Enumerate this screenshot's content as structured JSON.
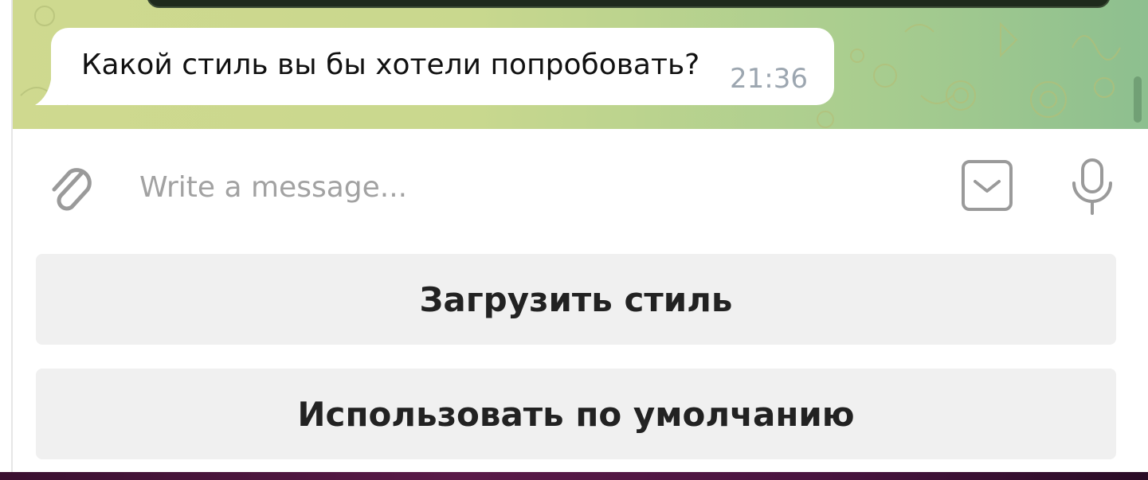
{
  "chat": {
    "message_text": "Какой стиль вы бы хотели попробовать?",
    "message_time": "21:36"
  },
  "composer": {
    "placeholder": "Write a message...",
    "attach_icon": "paperclip-icon",
    "keyboard_icon": "keyboard-toggle-icon",
    "mic_icon": "microphone-icon"
  },
  "reply_keyboard": {
    "buttons": [
      {
        "label": "Загрузить стиль"
      },
      {
        "label": "Использовать по умолчанию"
      }
    ]
  },
  "colors": {
    "wallpaper_left": "#cfd98f",
    "wallpaper_right": "#8dbf8f",
    "bubble": "#ffffff",
    "time": "#9ca6b0",
    "button_bg": "#f0f0f0",
    "icon_gray": "#9a9a9a"
  }
}
